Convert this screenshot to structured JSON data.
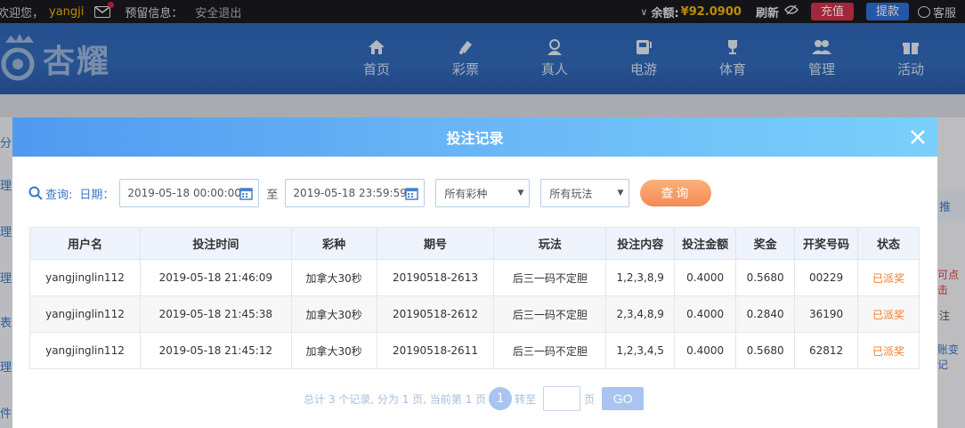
{
  "topbar": {
    "welcome": "欢迎您，",
    "username": "yangji",
    "reserve_info": "预留信息：",
    "logout": "安全退出",
    "balance_label": "余额:",
    "balance_value": "¥92.0900",
    "refresh": "刷新",
    "recharge": "充值",
    "withdraw": "提款",
    "service": "客服"
  },
  "logo_text": "杏耀",
  "nav": [
    {
      "label": "首页",
      "icon": "home-icon"
    },
    {
      "label": "彩票",
      "icon": "ticket-icon"
    },
    {
      "label": "真人",
      "icon": "dealer-icon"
    },
    {
      "label": "电游",
      "icon": "slot-machine-icon"
    },
    {
      "label": "体育",
      "icon": "trophy-icon"
    },
    {
      "label": "管理",
      "icon": "users-icon"
    },
    {
      "label": "活动",
      "icon": "gift-icon"
    }
  ],
  "background": {
    "left_chars": [
      "分",
      "理",
      "理",
      "理",
      "表",
      "理",
      "件"
    ],
    "right_tab": "推",
    "right_line1": "可点击",
    "right_line2": "注",
    "right_line3": "账变记"
  },
  "modal": {
    "title": "投注记录",
    "filters": {
      "query_label": "查询:",
      "date_label": "日期：",
      "start_date": "2019-05-18 00:00:00",
      "to_label": "至",
      "end_date": "2019-05-18 23:59:59",
      "lottery_select": "所有彩种",
      "play_select": "所有玩法",
      "query_button": "查询"
    },
    "table": {
      "headers": [
        "用户名",
        "投注时间",
        "彩种",
        "期号",
        "玩法",
        "投注内容",
        "投注金额",
        "奖金",
        "开奖号码",
        "状态"
      ],
      "rows": [
        [
          "yangjinglin112",
          "2019-05-18 21:46:09",
          "加拿大30秒",
          "20190518-2613",
          "后三一码不定胆",
          "1,2,3,8,9",
          "0.4000",
          "0.5680",
          "00229",
          "已派奖"
        ],
        [
          "yangjinglin112",
          "2019-05-18 21:45:38",
          "加拿大30秒",
          "20190518-2612",
          "后三一码不定胆",
          "2,3,4,8,9",
          "0.4000",
          "0.2840",
          "36190",
          "已派奖"
        ],
        [
          "yangjinglin112",
          "2019-05-18 21:45:12",
          "加拿大30秒",
          "20190518-2611",
          "后三一码不定胆",
          "1,2,3,4,5",
          "0.4000",
          "0.5680",
          "62812",
          "已派奖"
        ]
      ]
    },
    "pager": {
      "summary": "总计 3 个记录, 分为 1 页, 当前第 1 页",
      "current_page": "1",
      "goto_label": "转至",
      "page_unit": "页",
      "go_button": "GO"
    }
  },
  "colors": {
    "accent_blue": "#3a76c9",
    "status_orange": "#ef7d2b",
    "balance_gold": "#f4b400",
    "recharge_red": "#d3314c",
    "withdraw_blue": "#2f6fd8"
  }
}
